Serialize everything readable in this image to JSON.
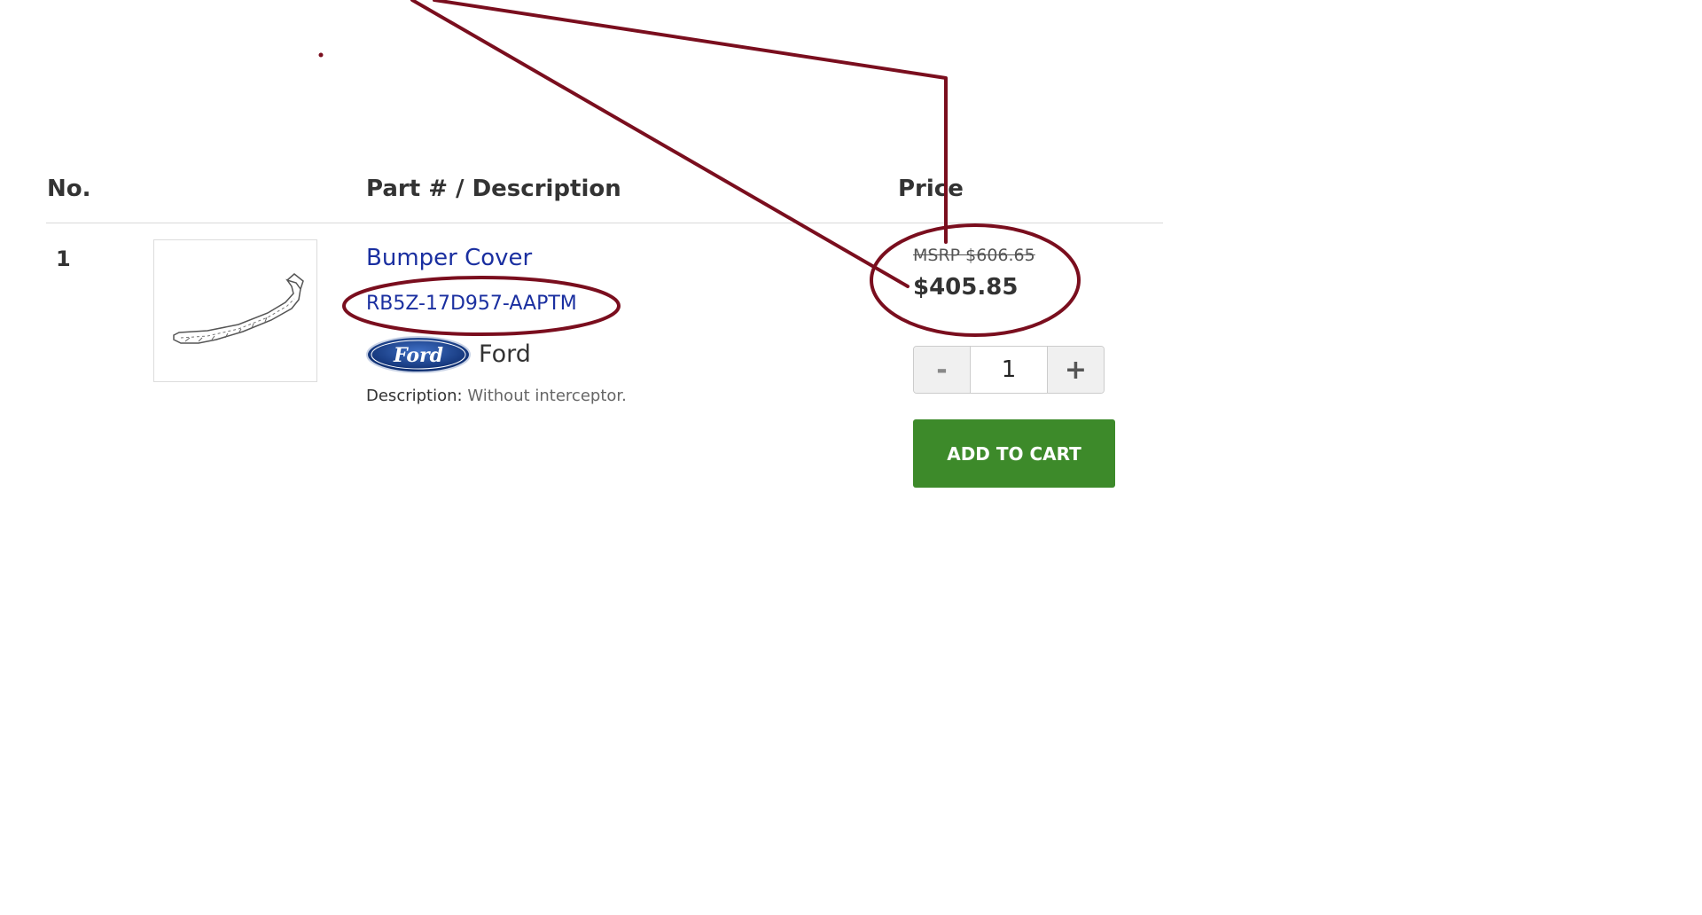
{
  "table": {
    "headers": {
      "no": "No.",
      "part": "Part # / Description",
      "price": "Price"
    }
  },
  "item": {
    "no": "1",
    "name": "Bumper Cover",
    "part_number": "RB5Z-17D957-AAPTM",
    "brand": "Ford",
    "description_label": "Description:",
    "description_text": " Without interceptor.",
    "msrp": "MSRP $606.65",
    "price": "$405.85",
    "quantity": "1",
    "qty_minus": "-",
    "qty_plus": "+",
    "add_to_cart": "ADD TO CART",
    "image_icon": "bumper-cover-drawing"
  },
  "colors": {
    "link": "#1a2fa0",
    "cart_button": "#3d8a2a",
    "annotation": "#7a0e1e"
  }
}
